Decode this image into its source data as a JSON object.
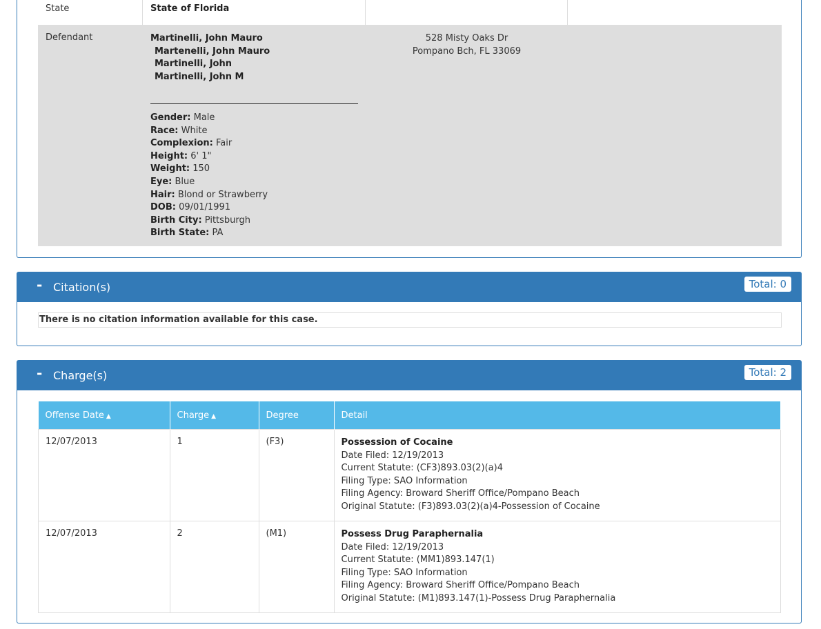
{
  "party": {
    "state_row": {
      "type": "State",
      "name": "State of Florida"
    },
    "defendant_row": {
      "type": "Defendant",
      "names": [
        "Martinelli, John Mauro",
        "Martenelli, John Mauro",
        "Martinelli, John",
        "Martinelli, John M"
      ],
      "address_line1": "528 Misty Oaks Dr",
      "address_line2": "Pompano Bch, FL 33069",
      "details": [
        {
          "label": "Gender:",
          "value": "Male"
        },
        {
          "label": "Race:",
          "value": "White"
        },
        {
          "label": "Complexion:",
          "value": "Fair"
        },
        {
          "label": "Height:",
          "value": "6' 1\""
        },
        {
          "label": "Weight:",
          "value": "150"
        },
        {
          "label": "Eye:",
          "value": "Blue"
        },
        {
          "label": "Hair:",
          "value": "Blond or Strawberry"
        },
        {
          "label": "DOB:",
          "value": "09/01/1991"
        },
        {
          "label": "Birth City:",
          "value": "Pittsburgh"
        },
        {
          "label": "Birth State:",
          "value": "PA"
        }
      ]
    }
  },
  "citations": {
    "collapse_symbol": "-",
    "title": "Citation(s)",
    "total": "Total: 0",
    "empty_message": "There is no citation information available for this case."
  },
  "charges": {
    "collapse_symbol": "-",
    "title": "Charge(s)",
    "total": "Total: 2",
    "columns": [
      "Offense Date",
      "Charge",
      "Degree",
      "Detail"
    ],
    "sort_icon": "sort-icon",
    "rows": [
      {
        "offense_date": "12/07/2013",
        "charge": "1",
        "degree": "(F3)",
        "title": "Possession of Cocaine",
        "lines": [
          "Date Filed: 12/19/2013",
          "Current Statute: (CF3)893.03(2)(a)4",
          "Filing Type: SAO Information",
          "Filing Agency: Broward Sheriff Office/Pompano Beach",
          "Original Statute: (F3)893.03(2)(a)4-Possession of Cocaine"
        ]
      },
      {
        "offense_date": "12/07/2013",
        "charge": "2",
        "degree": "(M1)",
        "title": "Possess Drug Paraphernalia",
        "lines": [
          "Date Filed: 12/19/2013",
          "Current Statute: (MM1)893.147(1)",
          "Filing Type: SAO Information",
          "Filing Agency: Broward Sheriff Office/Pompano Beach",
          "Original Statute: (M1)893.147(1)-Possess Drug Paraphernalia"
        ]
      }
    ]
  }
}
